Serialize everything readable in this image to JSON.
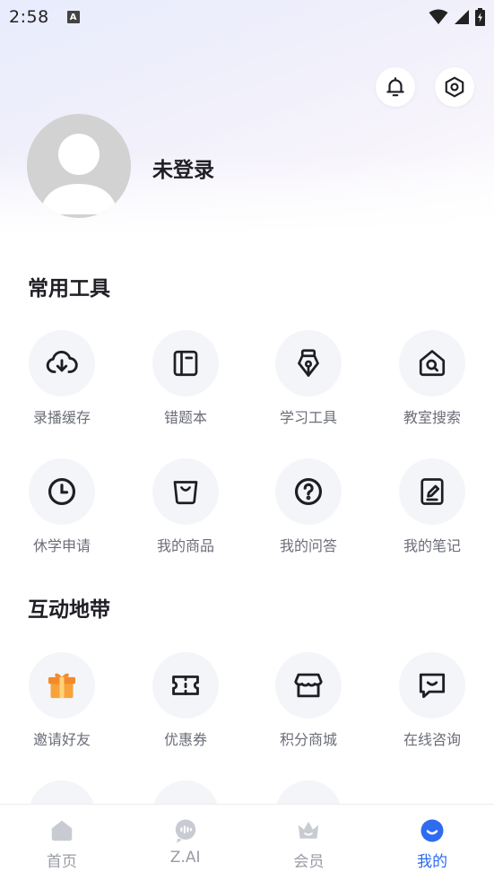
{
  "status_bar": {
    "time": "2:58",
    "notification_glyph": "A"
  },
  "profile": {
    "login_status": "未登录"
  },
  "sections": {
    "common_tools": {
      "title": "常用工具",
      "items": [
        {
          "label": "录播缓存",
          "icon": "cloud-download-icon"
        },
        {
          "label": "错题本",
          "icon": "notebook-icon"
        },
        {
          "label": "学习工具",
          "icon": "pen-nib-icon"
        },
        {
          "label": "教室搜索",
          "icon": "house-search-icon"
        },
        {
          "label": "休学申请",
          "icon": "clock-icon"
        },
        {
          "label": "我的商品",
          "icon": "shopping-bag-icon"
        },
        {
          "label": "我的问答",
          "icon": "question-icon"
        },
        {
          "label": "我的笔记",
          "icon": "note-edit-icon"
        }
      ]
    },
    "interaction": {
      "title": "互动地带",
      "items": [
        {
          "label": "邀请好友",
          "icon": "gift-icon"
        },
        {
          "label": "优惠券",
          "icon": "ticket-icon"
        },
        {
          "label": "积分商城",
          "icon": "store-icon"
        },
        {
          "label": "在线咨询",
          "icon": "chat-icon"
        }
      ]
    }
  },
  "tabbar": {
    "tabs": [
      {
        "label": "首页",
        "icon": "home-icon"
      },
      {
        "label": "Z.AI",
        "icon": "ai-voice-icon"
      },
      {
        "label": "会员",
        "icon": "crown-icon"
      },
      {
        "label": "我的",
        "icon": "smile-icon"
      }
    ],
    "active_color": "#2e6bf0",
    "inactive_color": "#9a9ca6"
  }
}
